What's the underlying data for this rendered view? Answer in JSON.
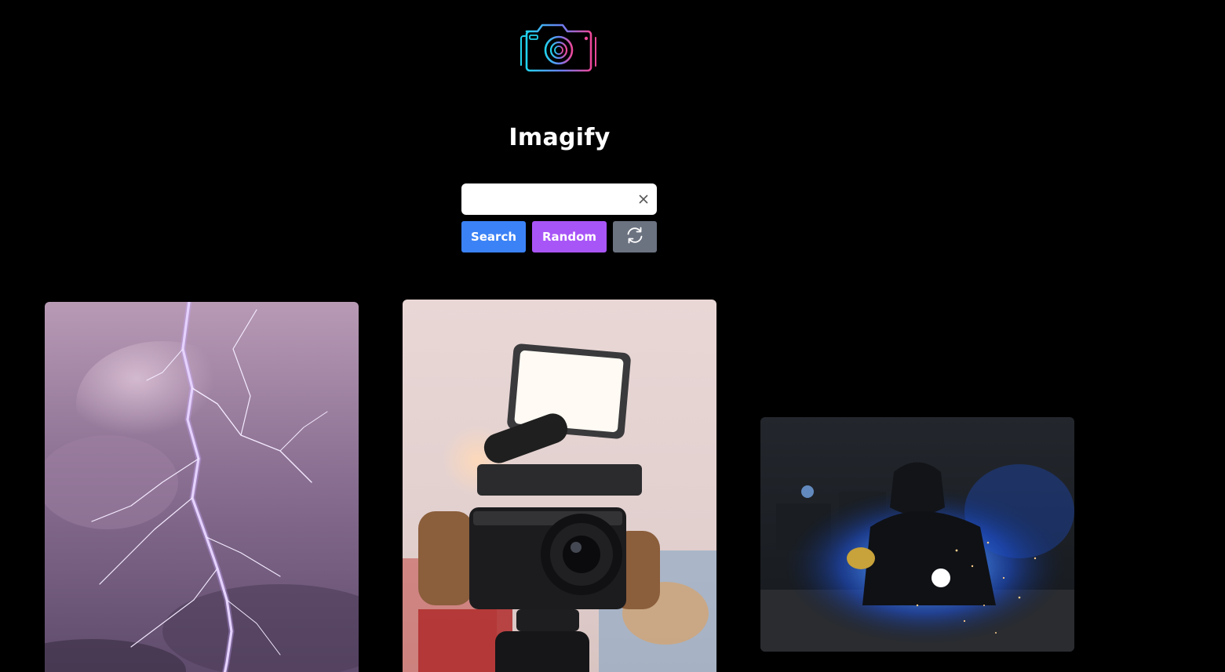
{
  "app": {
    "title": "Imagify"
  },
  "search": {
    "value": "",
    "placeholder": ""
  },
  "buttons": {
    "search_label": "Search",
    "random_label": "Random"
  },
  "icons": {
    "logo": "camera-logo-icon",
    "clear": "close-icon",
    "refresh": "refresh-icon"
  },
  "colors": {
    "background": "#000000",
    "search_button": "#3b82f6",
    "random_button": "#a855f7",
    "refresh_button": "#6b7280",
    "logo_gradient_start": "#22d3ee",
    "logo_gradient_end": "#ec4899"
  },
  "gallery": {
    "images": [
      {
        "subject": "lightning"
      },
      {
        "subject": "camera-rig"
      },
      {
        "subject": "welder"
      }
    ]
  }
}
